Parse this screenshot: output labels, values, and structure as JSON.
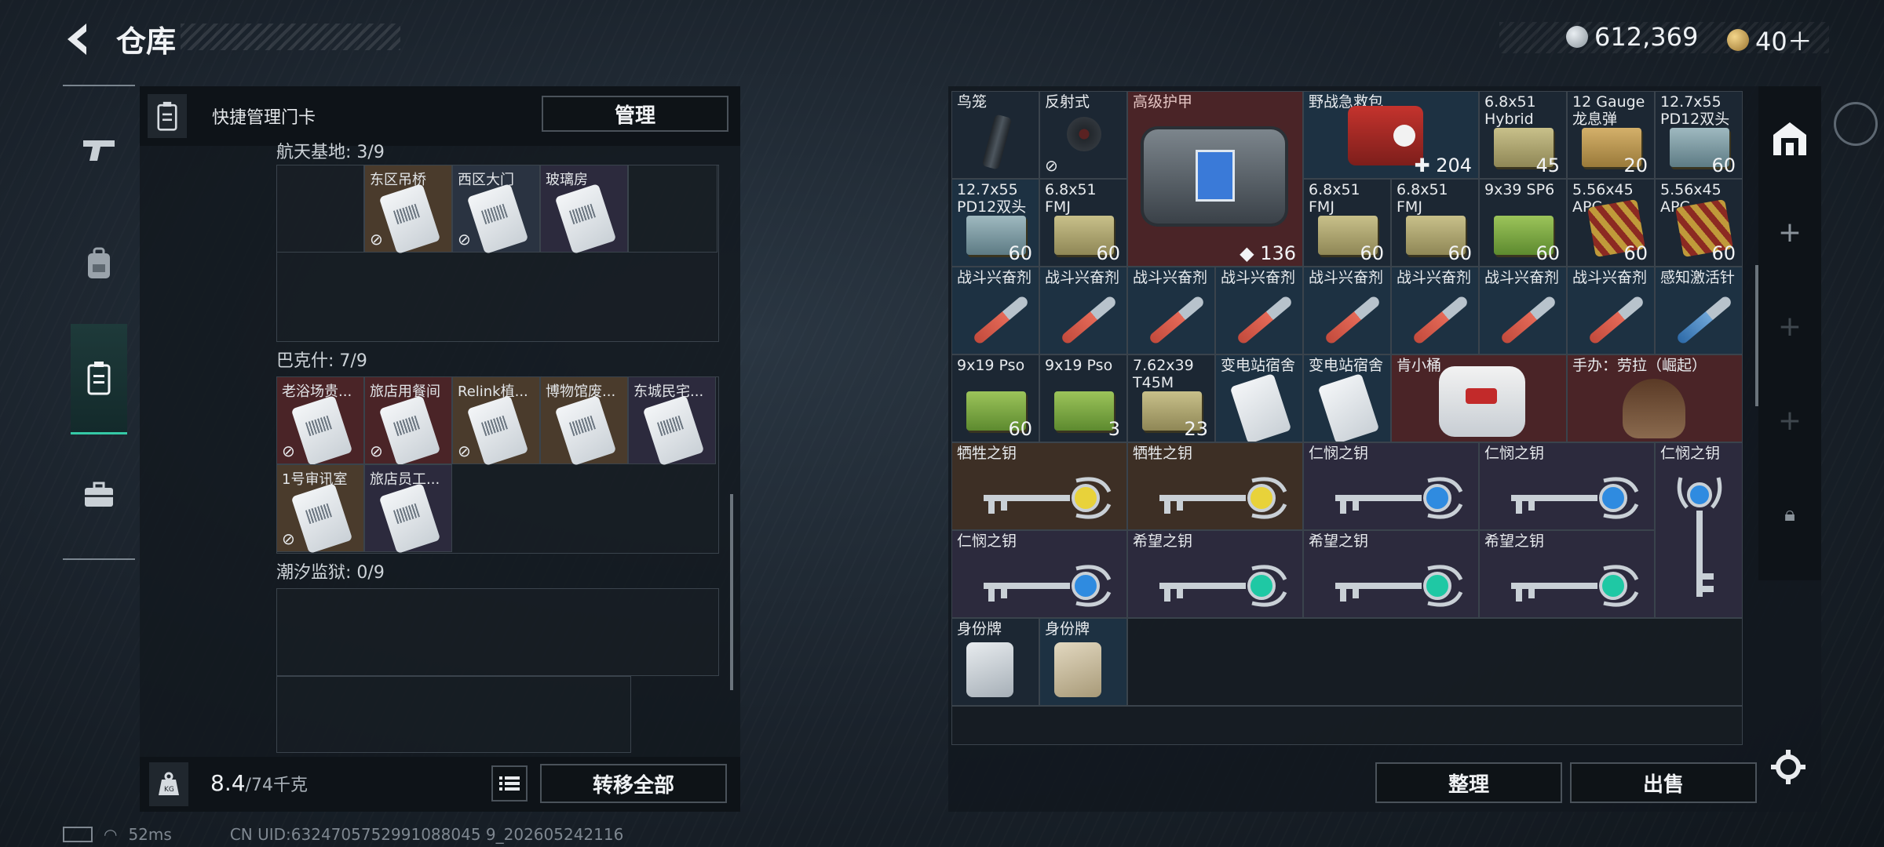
{
  "header": {
    "title": "仓库",
    "currency_silver": "612,369",
    "currency_gold": "40＋"
  },
  "left": {
    "quick_manage_label": "快捷管理门卡",
    "manage_button": "管理",
    "groups": [
      {
        "title": "航天基地: 3/9",
        "items": [
          "东区吊桥",
          "西区大门",
          "玻璃房"
        ]
      },
      {
        "title": "巴克什: 7/9",
        "items": [
          "老浴场贵...",
          "旅店用餐间",
          "Relink植...",
          "博物馆废...",
          "东城民宅...",
          "1号审讯室",
          "旅店员工..."
        ]
      },
      {
        "title": "潮汐监狱: 0/9",
        "items": []
      }
    ],
    "weight_value": "8.4",
    "weight_unit": "/74千克",
    "transfer_all_button": "转移全部"
  },
  "right": {
    "items": [
      {
        "name": "鸟笼",
        "count": ""
      },
      {
        "name": "反射式",
        "count": ""
      },
      {
        "name": "高级护甲",
        "count": "136"
      },
      {
        "name": "野战急救包",
        "count": "204"
      },
      {
        "name": "6.8x51 Hybrid",
        "count": "45"
      },
      {
        "name": "12 Gauge 龙息弹",
        "count": "20"
      },
      {
        "name": "12.7x55 PD12双头",
        "count": "60"
      },
      {
        "name": "12.7x55 PD12双头",
        "count": "60"
      },
      {
        "name": "6.8x51 FMJ",
        "count": "60"
      },
      {
        "name": "6.8x51 FMJ",
        "count": "60"
      },
      {
        "name": "6.8x51 FMJ",
        "count": "60"
      },
      {
        "name": "9x39 SP6",
        "count": "60"
      },
      {
        "name": "5.56x45 APC",
        "count": "60"
      },
      {
        "name": "5.56x45 APC",
        "count": "60"
      },
      {
        "name": "战斗兴奋剂",
        "count": ""
      },
      {
        "name": "感知激活针",
        "count": ""
      },
      {
        "name": "9x19 Pso",
        "count": "60"
      },
      {
        "name": "9x19 Pso",
        "count": "3"
      },
      {
        "name": "7.62x39 T45M",
        "count": "23"
      },
      {
        "name": "变电站宿舍",
        "count": ""
      },
      {
        "name": "肯小桶",
        "count": ""
      },
      {
        "name": "手办：劳拉（崛起）",
        "count": ""
      },
      {
        "name": "牺牲之钥",
        "count": ""
      },
      {
        "name": "仁悯之钥",
        "count": ""
      },
      {
        "name": "希望之钥",
        "count": ""
      },
      {
        "name": "身份牌",
        "count": ""
      }
    ],
    "sort_button": "整理",
    "sell_button": "出售"
  },
  "status": {
    "ping": "52ms",
    "uid": "CN UID:6324705752991088045 9_202605242116"
  },
  "colors": {
    "accent": "#35c9a6",
    "red_cell": "#4a2427",
    "blue_cell": "#1d3142"
  },
  "icons": [
    "back-arrow-icon",
    "silver-coin-icon",
    "gold-coin-icon",
    "pistol-icon",
    "backpack-icon",
    "keycard-icon",
    "briefcase-icon",
    "weight-icon",
    "list-icon",
    "gear-icon",
    "plus-icon",
    "lock-icon",
    "no-loss-icon"
  ]
}
